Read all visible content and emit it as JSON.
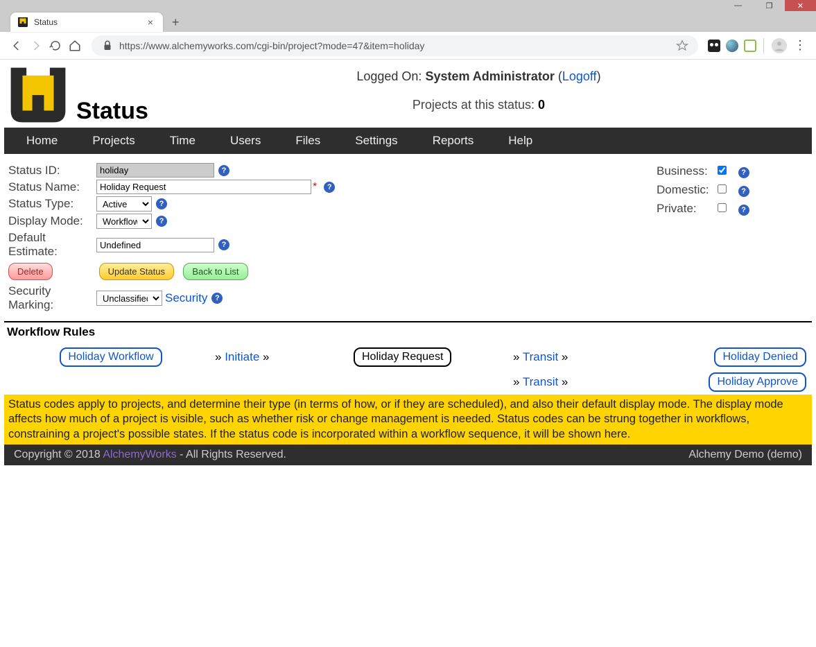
{
  "browser": {
    "tab_title": "Status",
    "url": "https://www.alchemyworks.com/cgi-bin/project?mode=47&item=holiday"
  },
  "header": {
    "logged_on_prefix": "Logged On: ",
    "user": "System Administrator",
    "logoff": "Logoff",
    "projects_status_label": "Projects at this status: ",
    "projects_status_count": "0",
    "page_title": "Status"
  },
  "nav": {
    "home": "Home",
    "projects": "Projects",
    "time": "Time",
    "users": "Users",
    "files": "Files",
    "settings": "Settings",
    "reports": "Reports",
    "help": "Help"
  },
  "form": {
    "status_id_label": "Status ID:",
    "status_id_value": "holiday",
    "status_name_label": "Status Name:",
    "status_name_value": "Holiday Request",
    "status_type_label": "Status Type:",
    "status_type_value": "Active",
    "display_mode_label": "Display Mode:",
    "display_mode_value": "Workflow",
    "default_estimate_label": "Default Estimate:",
    "default_estimate_value": "Undefined",
    "security_marking_label": "Security Marking:",
    "security_marking_value": "Unclassified",
    "security_link": "Security",
    "delete_btn": "Delete",
    "update_btn": "Update Status",
    "back_btn": "Back to List"
  },
  "flags": {
    "business_label": "Business:",
    "business_checked": true,
    "domestic_label": "Domestic:",
    "domestic_checked": false,
    "private_label": "Private:",
    "private_checked": false
  },
  "workflow": {
    "title": "Workflow Rules",
    "workflow_pill": "Holiday Workflow",
    "initiate": "Initiate",
    "current_pill": "Holiday Request",
    "transit1": "Transit",
    "transit2": "Transit",
    "denied_pill": "Holiday Denied",
    "approve_pill": "Holiday Approve"
  },
  "info": "Status codes apply to projects, and determine their type (in terms of how, or if they are scheduled), and also their default display mode. The display mode affects how much of a project is visible, such as whether risk or change management is needed. Status codes can be strung together in workflows, constraining a project's possible states. If the status code is incorporated within a workflow sequence, it will be shown here.",
  "footer": {
    "copyright_pre": "Copyright © 2018 ",
    "brand": "AlchemyWorks",
    "copyright_post": " - All Rights Reserved.",
    "right": "Alchemy Demo (demo)"
  }
}
